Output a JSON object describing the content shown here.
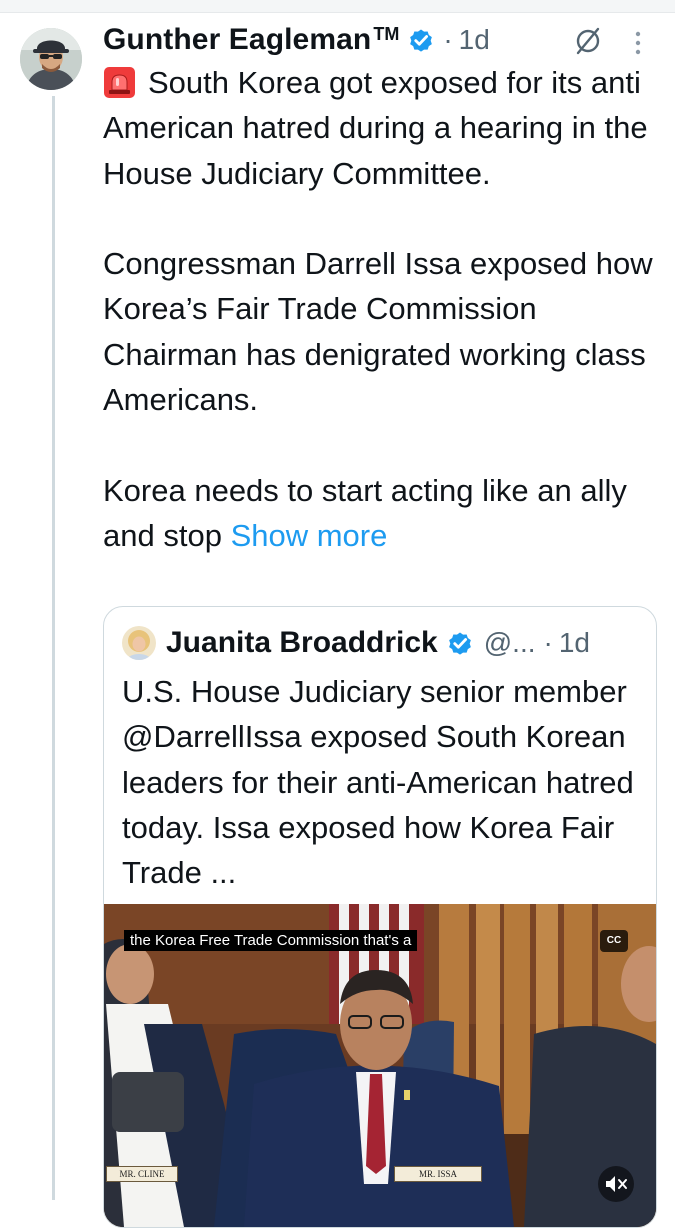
{
  "post": {
    "author_name": "Gunther Eagleman",
    "trademark": "TM",
    "separator": "·",
    "time": "1d",
    "verified": true,
    "text": {
      "line1": "South Korea got exposed for its anti American hatred during a hearing in the House Judiciary Committee.",
      "line2": "Congressman Darrell Issa exposed how Korea’s Fair Trade Commission Chairman has denigrated working class Americans.",
      "line3": "Korea needs to start acting like an ally and stop",
      "show_more": "Show more"
    }
  },
  "quote": {
    "author_name": "Juanita Broaddrick",
    "handle": "@...",
    "separator": "·",
    "time": "1d",
    "verified": true,
    "text": "U.S. House Judiciary senior member @DarrellIssa exposed South Korean leaders for their anti-American hatred today. Issa exposed how Korea Fair Trade ...",
    "video": {
      "caption": "the Korea Free Trade Commission that's a",
      "cc_label": "CC",
      "nameplate_left": "MR. CLINE",
      "nameplate_center": "MR. ISSA"
    }
  },
  "icons": {
    "siren": "siren-emoji-icon",
    "verified": "verified-badge-icon",
    "grok": "grok-icon",
    "more": "more-options-icon",
    "mute": "muted-volume-icon"
  },
  "colors": {
    "link": "#1d9bf0",
    "verified": "#1d9bf0",
    "secondary_text": "#536471",
    "thread_line": "#cfd9de"
  }
}
